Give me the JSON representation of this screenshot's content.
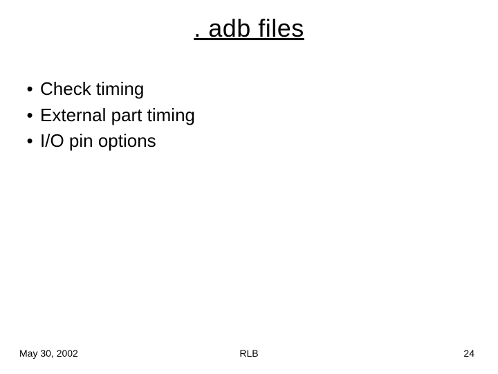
{
  "title": ". adb files",
  "bullets": [
    "Check timing",
    "External part timing",
    "I/O pin options"
  ],
  "footer": {
    "date": "May 30, 2002",
    "author": "RLB",
    "page": "24"
  },
  "bullet_glyph": "•"
}
